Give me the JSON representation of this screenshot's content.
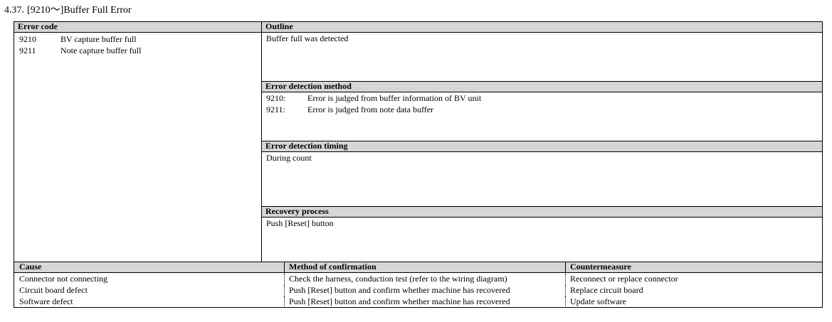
{
  "heading": {
    "number": "4.37.",
    "title": "[9210～]Buffer Full Error"
  },
  "error_code": {
    "label": "Error code",
    "items": [
      {
        "code": "9210",
        "desc": "BV capture buffer full"
      },
      {
        "code": "9211",
        "desc": "Note capture buffer full"
      }
    ]
  },
  "outline": {
    "label": "Outline",
    "text": "Buffer full was detected"
  },
  "detection_method": {
    "label": "Error detection method",
    "items": [
      {
        "code": "9210:",
        "desc": "Error is judged from buffer information of BV unit"
      },
      {
        "code": "9211:",
        "desc": "Error is judged from note data buffer"
      }
    ]
  },
  "detection_timing": {
    "label": "Error detection timing",
    "text": "During count"
  },
  "recovery": {
    "label": "Recovery process",
    "text": "Push [Reset] button"
  },
  "cause_table": {
    "headers": {
      "cause": "Cause",
      "method": "Method of confirmation",
      "measure": "Countermeasure"
    },
    "rows": [
      {
        "cause": "Connector not connecting",
        "method": "Check the harness, conduction test (refer to the wiring diagram)",
        "measure": "Reconnect or replace connector"
      },
      {
        "cause": "Circuit board defect",
        "method": "Push [Reset] button and confirm whether machine has recovered",
        "measure": "Replace circuit board"
      },
      {
        "cause": "Software defect",
        "method": "Push [Reset] button and confirm whether machine has recovered",
        "measure": "Update software"
      }
    ]
  }
}
